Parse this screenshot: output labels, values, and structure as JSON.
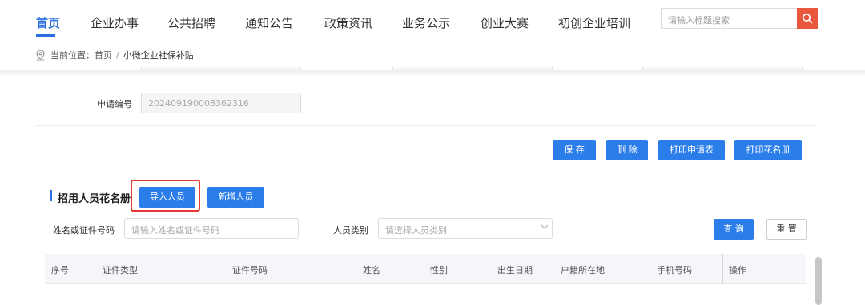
{
  "nav": {
    "items": [
      {
        "label": "首页",
        "active": true
      },
      {
        "label": "企业办事"
      },
      {
        "label": "公共招聘"
      },
      {
        "label": "通知公告"
      },
      {
        "label": "政策资讯"
      },
      {
        "label": "业务公示"
      },
      {
        "label": "创业大赛"
      },
      {
        "label": "初创企业培训"
      }
    ],
    "search_placeholder": "请输入标题搜索",
    "search_icon": "search-icon",
    "accent_color": "#2b6fe0",
    "search_button_color": "#e8573e"
  },
  "breadcrumb": {
    "prefix": "当前位置：",
    "home": "首页",
    "separator": "/",
    "current": "小微企业社保补贴"
  },
  "form": {
    "application_no_label": "申请编号",
    "application_no_value": "202409190008362316"
  },
  "actions": {
    "save": "保 存",
    "delete": "删 除",
    "print_application": "打印申请表",
    "print_roster": "打印花名册"
  },
  "roster": {
    "title": "招用人员花名册",
    "import_button": "导入人员",
    "add_button": "新增人员",
    "filter_name_label": "姓名或证件号码",
    "filter_name_placeholder": "请输入姓名或证件号码",
    "filter_type_label": "人员类别",
    "filter_type_placeholder": "请选择人员类别",
    "query_button": "查 询",
    "reset_button": "重 置",
    "columns": [
      "序号",
      "证件类型",
      "证件号码",
      "姓名",
      "性别",
      "出生日期",
      "户籍所在地",
      "手机号码",
      "操作"
    ]
  }
}
